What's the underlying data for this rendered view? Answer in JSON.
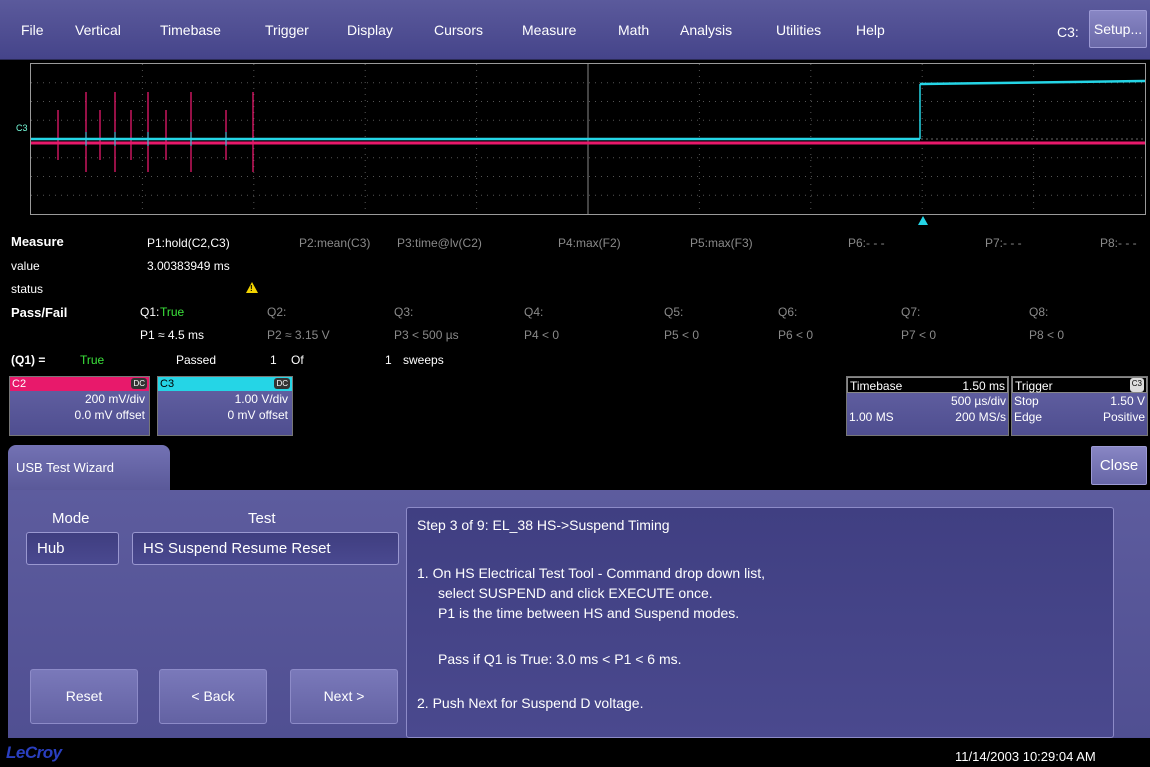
{
  "menu": {
    "items": [
      "File",
      "Vertical",
      "Timebase",
      "Trigger",
      "Display",
      "Cursors",
      "Measure",
      "Math",
      "Analysis",
      "Utilities",
      "Help"
    ],
    "channel_label": "C3:",
    "setup_label": "Setup..."
  },
  "grid": {
    "trace_label": "C3",
    "trace_colors": {
      "c2": "#e8196b",
      "c3": "#25d5e6"
    }
  },
  "measure": {
    "title": "Measure",
    "row_value": "value",
    "row_status": "status",
    "params": [
      "P1:hold(C2,C3)",
      "P2:mean(C3)",
      "P3:time@lv(C2)",
      "P4:max(F2)",
      "P5:max(F3)",
      "P6:- - -",
      "P7:- - -",
      "P8:- - -"
    ],
    "p1_value": "3.00383949 ms",
    "status_icon": "warning-icon"
  },
  "passfail": {
    "title": "Pass/Fail",
    "q1_label": "Q1:",
    "q1_value": "True",
    "queries": [
      "Q2:",
      "Q3:",
      "Q4:",
      "Q5:",
      "Q6:",
      "Q7:",
      "Q8:"
    ],
    "conditions": [
      "P1 ≈ 4.5 ms",
      "P2 ≈ 3.15 V",
      "P3 < 500 µs",
      "P4 < 0",
      "P5 < 0",
      "P6 < 0",
      "P7 < 0",
      "P8 < 0"
    ],
    "summary": {
      "q1": "(Q1) =",
      "result": "True",
      "passed": "Passed",
      "count": "1",
      "of": "Of",
      "total": "1",
      "sweeps": "sweeps"
    }
  },
  "channels": [
    {
      "name": "C2",
      "coupling": "DC",
      "scale": "200 mV/div",
      "offset": "0.0 mV offset",
      "color": "#e8196b"
    },
    {
      "name": "C3",
      "coupling": "DC",
      "scale": "1.00 V/div",
      "offset": "0 mV offset",
      "color": "#25d5e6"
    }
  ],
  "timebase": {
    "label": "Timebase",
    "value": "1.50 ms",
    "per_div": "500 µs/div",
    "samples": "1.00 MS",
    "rate": "200 MS/s"
  },
  "trigger": {
    "label": "Trigger",
    "source": "C3",
    "mode": "Stop",
    "level": "1.50 V",
    "type": "Edge",
    "slope": "Positive"
  },
  "wizard": {
    "tab_label": "USB Test Wizard",
    "close_label": "Close",
    "mode_label": "Mode",
    "mode_value": "Hub",
    "test_label": "Test",
    "test_value": "HS Suspend Resume Reset",
    "reset_label": "Reset",
    "back_label": "< Back",
    "next_label": "Next >",
    "instructions": [
      "Step  3 of 9: EL_38 HS->Suspend Timing",
      "1. On HS Electrical Test Tool - Command drop down list,",
      "select SUSPEND  and click EXECUTE once.",
      "P1 is the time between HS and Suspend modes.",
      "Pass if Q1 is True: 3.0 ms < P1 < 6 ms.",
      "2. Push Next for Suspend D voltage."
    ]
  },
  "footer": {
    "logo": "LeCroy",
    "timestamp": "11/14/2003 10:29:04 AM"
  }
}
